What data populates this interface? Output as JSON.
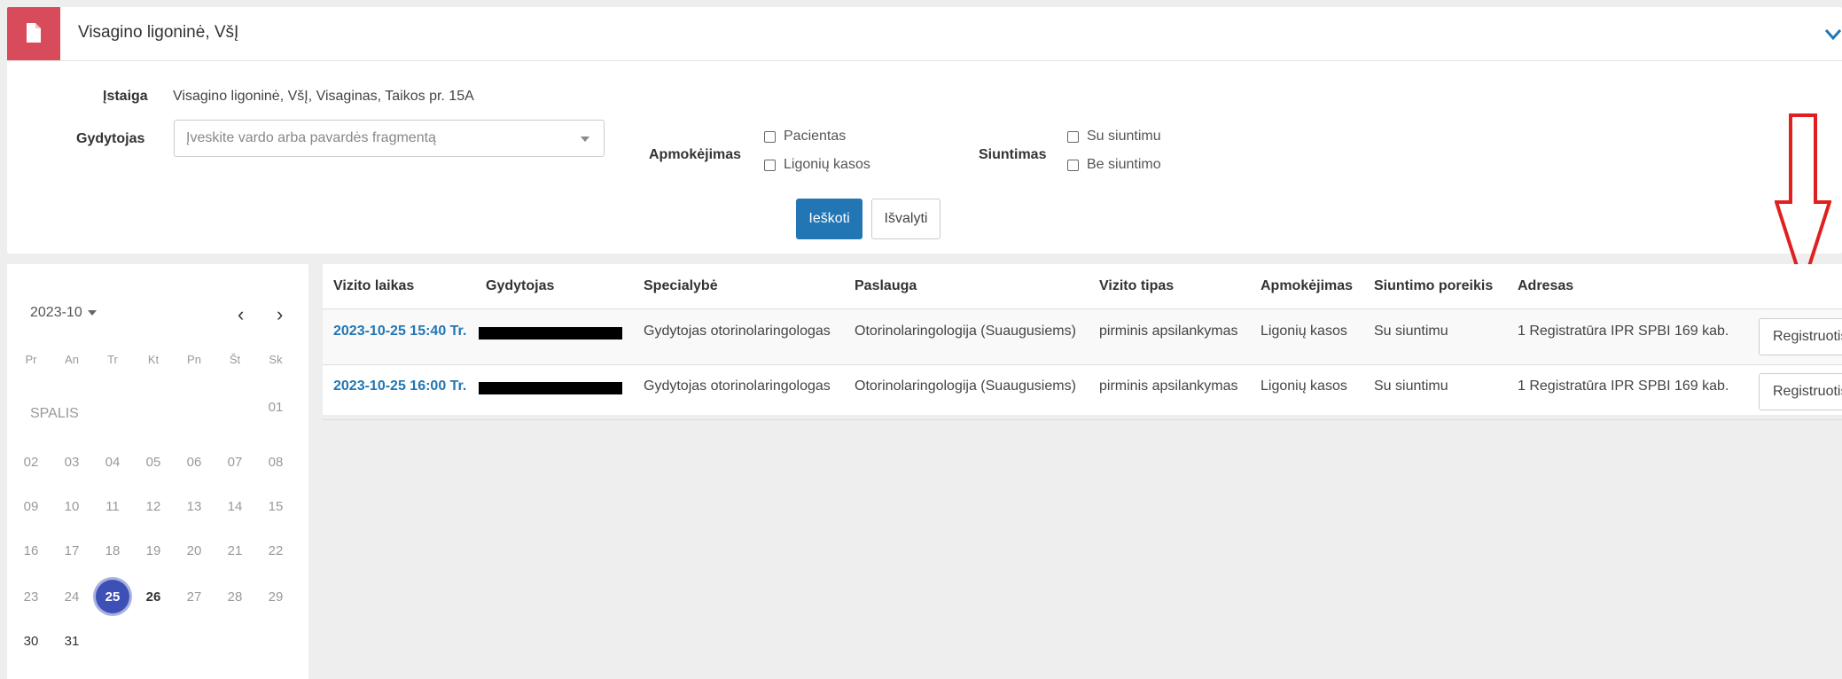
{
  "header": {
    "title": "Visagino ligoninė, VšĮ"
  },
  "filters": {
    "istaiga_label": "Įstaiga",
    "istaiga_value": "Visagino ligoninė, VšĮ, Visaginas, Taikos pr. 15A",
    "gydytojas_label": "Gydytojas",
    "gydytojas_placeholder": "Įveskite vardo arba pavardės fragmentą",
    "apmokejimas_label": "Apmokėjimas",
    "apmokejimas_options": [
      "Pacientas",
      "Ligonių kasos"
    ],
    "siuntimas_label": "Siuntimas",
    "siuntimas_options": [
      "Su siuntimu",
      "Be siuntimo"
    ],
    "search_button": "Ieškoti",
    "clear_button": "Išvalyti"
  },
  "calendar": {
    "month_select": "2023-10",
    "weekdays": [
      "Pr",
      "An",
      "Tr",
      "Kt",
      "Pn",
      "Št",
      "Sk"
    ],
    "month_label": "SPALIS",
    "selected_day": "25"
  },
  "table": {
    "columns": [
      "Vizito laikas",
      "Gydytojas",
      "Specialybė",
      "Paslauga",
      "Vizito tipas",
      "Apmokėjimas",
      "Siuntimo poreikis",
      "Adresas"
    ],
    "rows": [
      {
        "time": "2023-10-25 15:40 Tr.",
        "specialty": "Gydytojas otorinolaringologas",
        "service": "Otorinolaringologija (Suaugusiems)",
        "visit_type": "pirminis apsilankymas",
        "payment": "Ligonių kasos",
        "referral": "Su siuntimu",
        "address": "1 Registratūra IPR SPBI 169 kab.",
        "action": "Registruotis"
      },
      {
        "time": "2023-10-25 16:00 Tr.",
        "specialty": "Gydytojas otorinolaringologas",
        "service": "Otorinolaringologija (Suaugusiems)",
        "visit_type": "pirminis apsilankymas",
        "payment": "Ligonių kasos",
        "referral": "Su siuntimu",
        "address": "1 Registratūra IPR SPBI 169 kab.",
        "action": "Registruotis"
      }
    ]
  },
  "icons": {
    "header_icon": "document-icon",
    "collapse_icon": "chevron-down-icon",
    "annotation": "red-arrow-down-icon"
  },
  "colors": {
    "badge": "#d84b5a",
    "primary": "#2276b4",
    "selected_day": "#3d50b6",
    "annotation_arrow": "#e02020"
  }
}
